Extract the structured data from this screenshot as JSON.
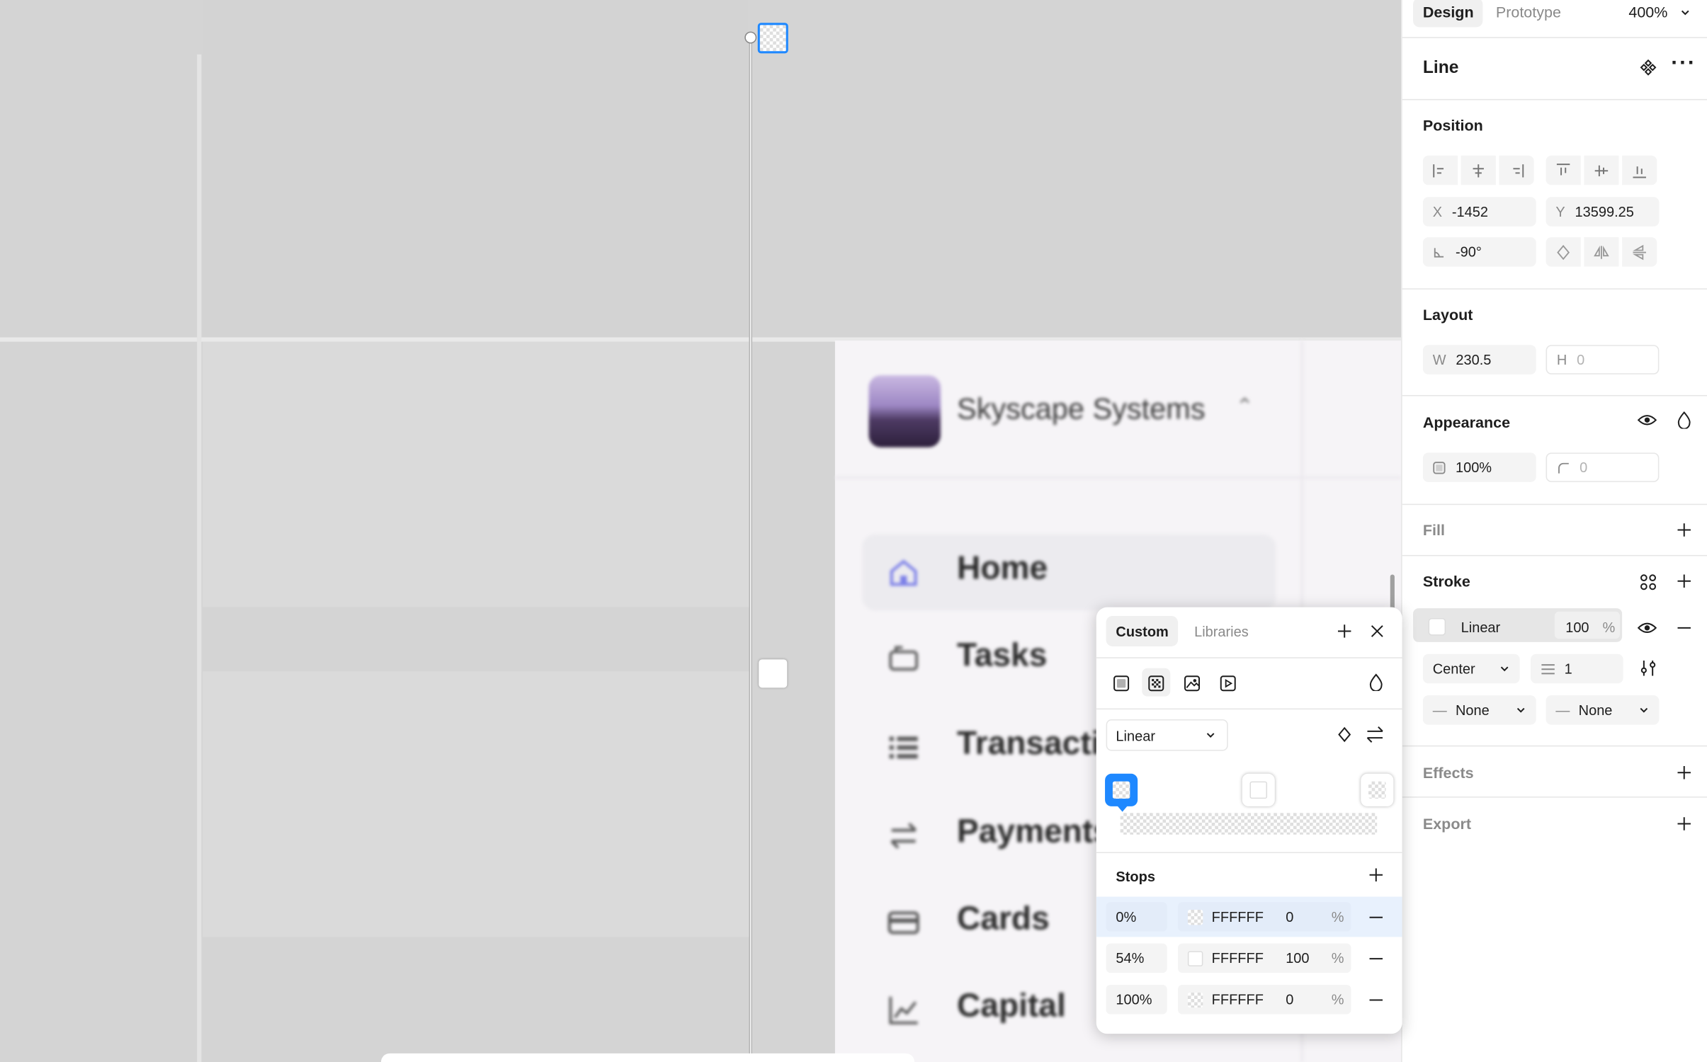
{
  "canvas": {
    "brand_name": "Skyscape Systems",
    "nav": [
      {
        "label": "Home",
        "icon": "home-icon"
      },
      {
        "label": "Tasks",
        "icon": "tasks-icon"
      },
      {
        "label": "Transacti",
        "icon": "list-icon"
      },
      {
        "label": "Payments",
        "icon": "transfer-icon"
      },
      {
        "label": "Cards",
        "icon": "card-icon"
      },
      {
        "label": "Capital",
        "icon": "chart-icon"
      }
    ]
  },
  "header": {
    "tab_design": "Design",
    "tab_prototype": "Prototype",
    "zoom": "400%"
  },
  "layer": {
    "name": "Line"
  },
  "position": {
    "title": "Position",
    "x_label": "X",
    "x": "-1452",
    "y_label": "Y",
    "y": "13599.25",
    "rotation": "-90°"
  },
  "layout": {
    "title": "Layout",
    "w_label": "W",
    "w": "230.5",
    "h_label": "H",
    "h": "0"
  },
  "appearance": {
    "title": "Appearance",
    "opacity": "100%",
    "radius": "0"
  },
  "fill": {
    "title": "Fill"
  },
  "stroke": {
    "title": "Stroke",
    "paint_type": "Linear",
    "opacity": "100",
    "pct": "%",
    "align": "Center",
    "weight": "1",
    "start_cap": "None",
    "end_cap": "None"
  },
  "effects": {
    "title": "Effects"
  },
  "export": {
    "title": "Export"
  },
  "picker": {
    "tab_custom": "Custom",
    "tab_libraries": "Libraries",
    "gradient_type": "Linear",
    "stops_title": "Stops",
    "stops": [
      {
        "position": "0%",
        "hex": "FFFFFF",
        "opacity": "0",
        "pct": "%"
      },
      {
        "position": "54%",
        "hex": "FFFFFF",
        "opacity": "100",
        "pct": "%"
      },
      {
        "position": "100%",
        "hex": "FFFFFF",
        "opacity": "0",
        "pct": "%"
      }
    ]
  },
  "colors": {
    "accent": "#1e88ff",
    "selected_row": "#e8f1fd"
  }
}
